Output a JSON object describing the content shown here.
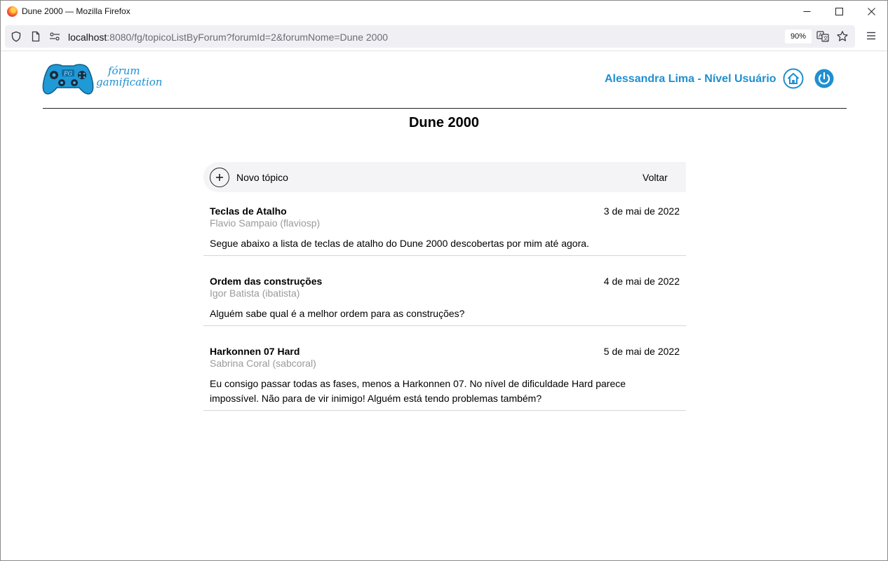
{
  "window": {
    "title": "Dune 2000 — Mozilla Firefox"
  },
  "browser": {
    "url_host": "localhost",
    "url_rest": ":8080/fg/topicoListByForum?forumId=2&forumNome=Dune 2000",
    "zoom": "90%"
  },
  "header": {
    "logo_line1": "fórum",
    "logo_line2": "gamification",
    "logo_badge": "FG",
    "user_label": "Alessandra Lima - Nível Usuário"
  },
  "forum": {
    "title": "Dune 2000"
  },
  "toolbar": {
    "new_topic_label": "Novo tópico",
    "back_label": "Voltar"
  },
  "topics": [
    {
      "title": "Teclas de Atalho",
      "author": "Flavio Sampaio (flaviosp)",
      "date": "3 de mai de 2022",
      "body": "Segue abaixo a lista de teclas de atalho do Dune 2000 descobertas por mim até agora."
    },
    {
      "title": "Ordem das construções",
      "author": "Igor Batista (ibatista)",
      "date": "4 de mai de 2022",
      "body": "Alguém sabe qual é a melhor ordem para as construções?"
    },
    {
      "title": "Harkonnen 07 Hard",
      "author": "Sabrina Coral (sabcoral)",
      "date": "5 de mai de 2022",
      "body": "Eu consigo passar todas as fases, menos a Harkonnen 07. No nível de dificuldade Hard parece impossível. Não para de vir inimigo! Alguém está tendo problemas também?"
    }
  ],
  "icons": {
    "shield": "shield-icon",
    "page": "page-icon",
    "permissions": "permissions-icon",
    "translate": "translate-icon",
    "bookmark": "star-icon",
    "menu": "hamburger-menu-icon",
    "home": "home-icon",
    "power": "power-icon",
    "plus": "plus-icon"
  },
  "colors": {
    "accent": "#1f8fd0",
    "author_gray": "#9a9a9a",
    "toolbar_bg": "#f4f4f6"
  }
}
